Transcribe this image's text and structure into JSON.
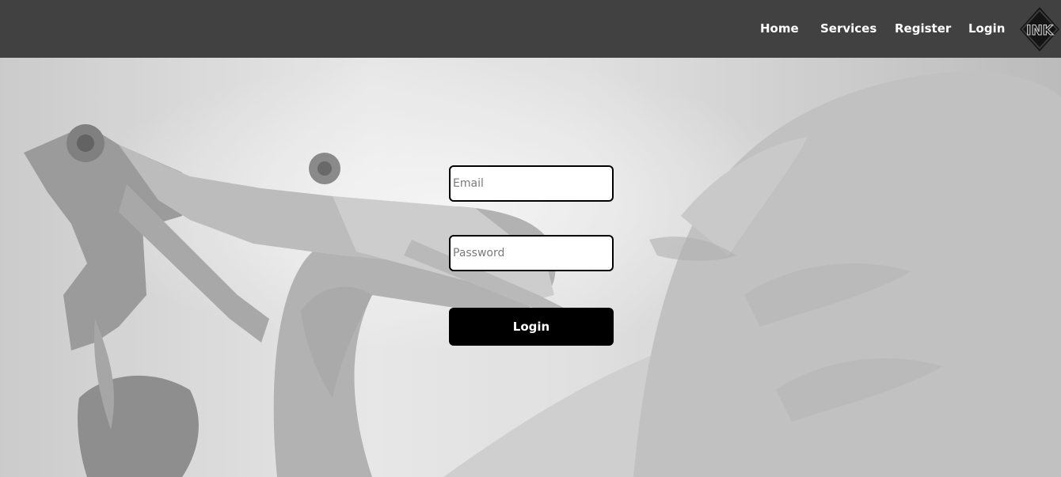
{
  "nav": {
    "links": [
      "Home",
      "Services",
      "Register",
      "Login"
    ],
    "logo": {
      "icon": "ink-logo-icon",
      "text": "INK"
    }
  },
  "hero": {
    "image": "tattoo-machine-gloved-hand-photo"
  },
  "form": {
    "email": {
      "value": "",
      "placeholder": "Email"
    },
    "password": {
      "value": "",
      "placeholder": "Password"
    },
    "submit_label": "Login"
  },
  "colors": {
    "navbar_bg": "#414141",
    "nav_text": "#ffffff",
    "button_bg": "#000000",
    "button_text": "#ffffff",
    "field_border": "#000000"
  }
}
